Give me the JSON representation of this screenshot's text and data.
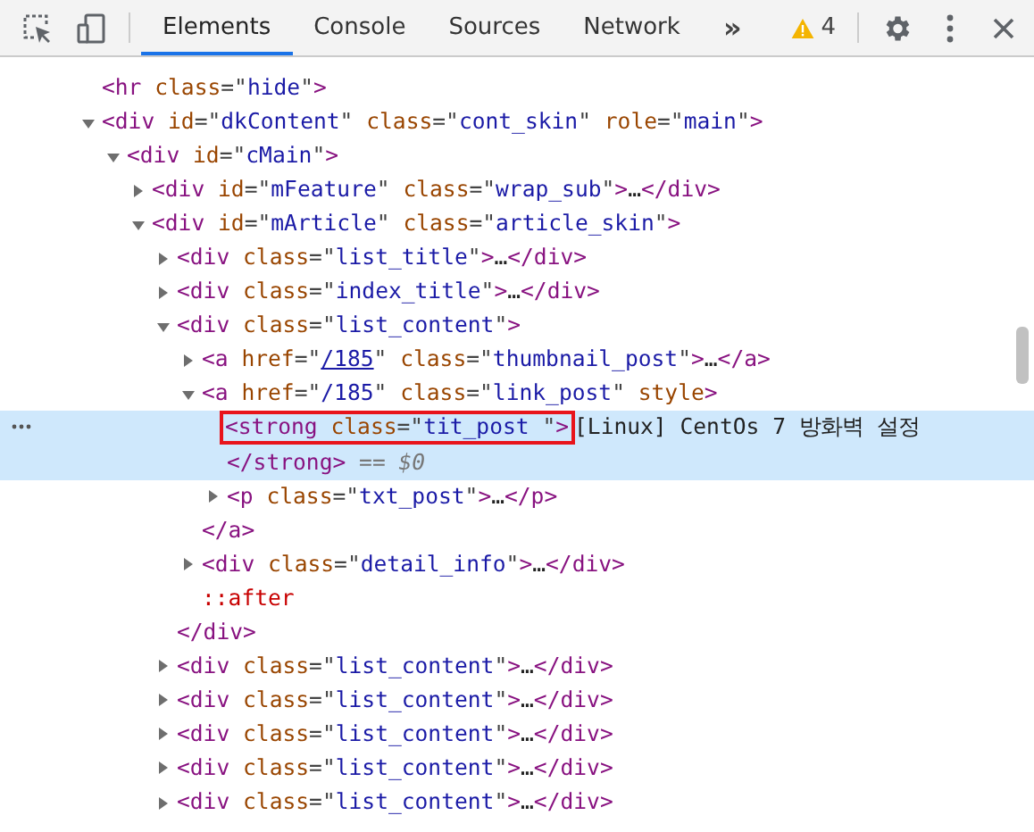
{
  "toolbar": {
    "tabs": [
      {
        "label": "Elements",
        "selected": true
      },
      {
        "label": "Console",
        "selected": false
      },
      {
        "label": "Sources",
        "selected": false
      },
      {
        "label": "Network",
        "selected": false
      }
    ],
    "more_tabs": "»",
    "warning_count": "4"
  },
  "tree": [
    {
      "code": "<hr class=\"hide\">",
      "selected": false
    },
    {
      "code": "<div id=\"dkContent\" class=\"cont_skin\" role=\"main\">",
      "expanded": true,
      "selected": false,
      "children": [
        {
          "code": "<div id=\"cMain\">",
          "expanded": true,
          "selected": false,
          "children": [
            {
              "code": "<div id=\"mFeature\" class=\"wrap_sub\">…</div>",
              "expanded": false,
              "selected": false
            },
            {
              "code": "<div id=\"mArticle\" class=\"article_skin\">",
              "expanded": true,
              "selected": false,
              "children": [
                {
                  "code": "<div class=\"list_title\">…</div>",
                  "expanded": false,
                  "selected": false
                },
                {
                  "code": "<div class=\"index_title\">…</div>",
                  "expanded": false,
                  "selected": false
                },
                {
                  "code": "<div class=\"list_content\">",
                  "expanded": true,
                  "selected": false,
                  "closing": "</div>",
                  "children": [
                    {
                      "code": "<a href=\"/185\" class=\"thumbnail_post\">…</a>",
                      "expanded": false,
                      "link": true,
                      "selected": false
                    },
                    {
                      "code": "<a href=\"/185\" class=\"link_post\" style>",
                      "expanded": true,
                      "selected": false,
                      "closing": "</a>",
                      "children": [
                        {
                          "code": "<strong class=\"tit_post \">",
                          "text": "[Linux] CentOs 7 방화벽 설정",
                          "closing": "</strong>",
                          "console_ref": "== $0",
                          "outlined": true,
                          "selected": true
                        },
                        {
                          "code": "<p class=\"txt_post\">…</p>",
                          "expanded": false,
                          "selected": false
                        }
                      ]
                    },
                    {
                      "code": "<div class=\"detail_info\">…</div>",
                      "expanded": false,
                      "selected": false
                    },
                    {
                      "code": "::after",
                      "kind": "pseudo",
                      "selected": false
                    }
                  ]
                },
                {
                  "code": "<div class=\"list_content\">…</div>",
                  "expanded": false,
                  "selected": false
                },
                {
                  "code": "<div class=\"list_content\">…</div>",
                  "expanded": false,
                  "selected": false
                },
                {
                  "code": "<div class=\"list_content\">…</div>",
                  "expanded": false,
                  "selected": false
                },
                {
                  "code": "<div class=\"list_content\">…</div>",
                  "expanded": false,
                  "selected": false
                },
                {
                  "code": "<div class=\"list_content\">…</div>",
                  "expanded": false,
                  "selected": false
                }
              ]
            }
          ]
        }
      ]
    }
  ]
}
